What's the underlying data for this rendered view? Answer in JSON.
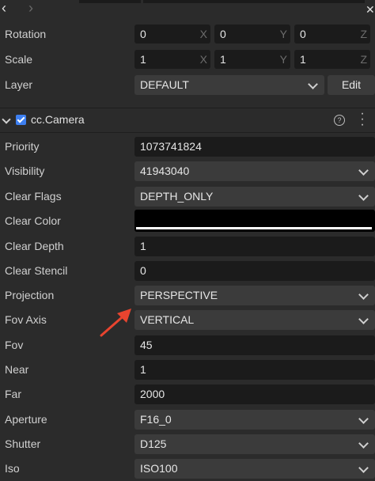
{
  "toolbar": {
    "back_icon": "‹",
    "forward_icon": "›",
    "close_icon": "✕"
  },
  "transform": {
    "rotation": {
      "label": "Rotation",
      "x": "0",
      "y": "0",
      "z": "0"
    },
    "scale": {
      "label": "Scale",
      "x": "1",
      "y": "1",
      "z": "1"
    },
    "axis_labels": {
      "x": "X",
      "y": "Y",
      "z": "Z"
    }
  },
  "layer": {
    "label": "Layer",
    "value": "DEFAULT",
    "edit_label": "Edit"
  },
  "component": {
    "title": "cc.Camera",
    "enabled": true,
    "help_icon": "?",
    "more_icon": "⋮"
  },
  "camera": {
    "priority": {
      "label": "Priority",
      "value": "1073741824"
    },
    "visibility": {
      "label": "Visibility",
      "value": "41943040"
    },
    "clear_flags": {
      "label": "Clear Flags",
      "value": "DEPTH_ONLY"
    },
    "clear_color": {
      "label": "Clear Color",
      "color": "#000000"
    },
    "clear_depth": {
      "label": "Clear Depth",
      "value": "1"
    },
    "clear_stencil": {
      "label": "Clear Stencil",
      "value": "0"
    },
    "projection": {
      "label": "Projection",
      "value": "PERSPECTIVE"
    },
    "fov_axis": {
      "label": "Fov Axis",
      "value": "VERTICAL"
    },
    "fov": {
      "label": "Fov",
      "value": "45"
    },
    "near": {
      "label": "Near",
      "value": "1"
    },
    "far": {
      "label": "Far",
      "value": "2000"
    },
    "aperture": {
      "label": "Aperture",
      "value": "F16_0"
    },
    "shutter": {
      "label": "Shutter",
      "value": "D125"
    },
    "iso": {
      "label": "Iso",
      "value": "ISO100"
    }
  },
  "colors": {
    "annotation_arrow": "#e8442f",
    "checkbox": "#3d7ff0"
  }
}
